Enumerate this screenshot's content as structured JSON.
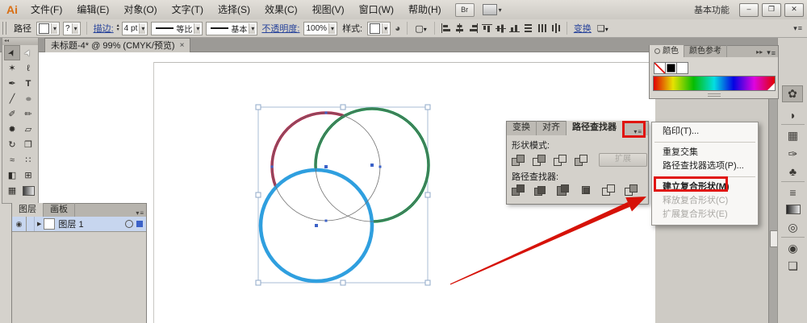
{
  "app": {
    "logo": "Ai",
    "workspace": "基本功能"
  },
  "menubar": {
    "items": [
      "文件(F)",
      "编辑(E)",
      "对象(O)",
      "文字(T)",
      "选择(S)",
      "效果(C)",
      "视图(V)",
      "窗口(W)",
      "帮助(H)"
    ],
    "br": "Br"
  },
  "window_buttons": {
    "minimize": "–",
    "restore": "❐",
    "close": "✕"
  },
  "controlbar": {
    "context": "路径",
    "stroke_question": "?",
    "stroke_label": "描边:",
    "stroke_value": "4 pt",
    "profile_value": "等比",
    "brush_value": "基本",
    "opacity_label": "不透明度:",
    "opacity_value": "100%",
    "style_label": "样式:",
    "transform_link": "变换"
  },
  "doc_tab": {
    "title": "未标题-4* @ 99% (CMYK/预览)",
    "close": "×"
  },
  "toolbar": {
    "tools": [
      {
        "name": "selection-tool",
        "glyph": "➤"
      },
      {
        "name": "direct-selection-tool",
        "glyph": "➤"
      },
      {
        "name": "magic-wand-tool",
        "glyph": "✶"
      },
      {
        "name": "lasso-tool",
        "glyph": "ℓ"
      },
      {
        "name": "pen-tool",
        "glyph": "✒"
      },
      {
        "name": "type-tool",
        "glyph": "T"
      },
      {
        "name": "line-tool",
        "glyph": "╱"
      },
      {
        "name": "ellipse-tool",
        "glyph": "●"
      },
      {
        "name": "paintbrush-tool",
        "glyph": "✐"
      },
      {
        "name": "pencil-tool",
        "glyph": "✏"
      },
      {
        "name": "blob-brush-tool",
        "glyph": "✹"
      },
      {
        "name": "eraser-tool",
        "glyph": "▱"
      },
      {
        "name": "rotate-tool",
        "glyph": "↻"
      },
      {
        "name": "artboard-tool",
        "glyph": "❐"
      },
      {
        "name": "width-tool",
        "glyph": "≈"
      },
      {
        "name": "free-transform-tool",
        "glyph": "∷"
      },
      {
        "name": "shape-builder-tool",
        "glyph": "◧"
      },
      {
        "name": "perspective-grid-tool",
        "glyph": "⊞"
      },
      {
        "name": "mesh-tool",
        "glyph": "▦"
      },
      {
        "name": "gradient-tool",
        "glyph": ""
      }
    ]
  },
  "layers_panel": {
    "tabs": [
      "图层",
      "画板"
    ],
    "layer_name": "图层 1"
  },
  "pathfinder_panel": {
    "tabs": [
      "变换",
      "对齐",
      "路径查找器"
    ],
    "shape_modes_label": "形状模式:",
    "expand_label": "扩展",
    "pathfinders_label": "路径查找器:"
  },
  "context_menu": {
    "items": [
      {
        "label": "陷印(T)...",
        "enabled": true
      },
      {
        "label": "重复交集",
        "enabled": true
      },
      {
        "label": "路径查找器选项(P)...",
        "enabled": true
      },
      {
        "label": "建立复合形状(M)",
        "enabled": true,
        "highlighted": true
      },
      {
        "label": "释放复合形状(C)",
        "enabled": false
      },
      {
        "label": "扩展复合形状(E)",
        "enabled": false
      }
    ]
  },
  "color_panel": {
    "tabs": [
      "颜色",
      "颜色参考"
    ]
  },
  "dock": {
    "icons": [
      {
        "name": "color-icon",
        "glyph": "✿"
      },
      {
        "name": "color-guide-icon",
        "glyph": "◗"
      },
      {
        "name": "swatches-icon",
        "glyph": "▦"
      },
      {
        "name": "brushes-icon",
        "glyph": "✑"
      },
      {
        "name": "symbols-icon",
        "glyph": "♣"
      },
      {
        "name": "stroke-icon",
        "glyph": "≡"
      },
      {
        "name": "gradient-icon",
        "glyph": ""
      },
      {
        "name": "transparency-icon",
        "glyph": "◎"
      },
      {
        "name": "appearance-icon",
        "glyph": "◉"
      },
      {
        "name": "graphic-styles-icon",
        "glyph": "❏"
      }
    ]
  },
  "canvas": {
    "circle_red_stroke": "#ac2a4d",
    "circle_green_stroke": "#1e8b4b",
    "circle_blue_stroke": "#2f9fdf"
  },
  "colors": {
    "highlight_red": "#e01410",
    "arrow_red": "#d61208"
  },
  "icons": {
    "dropdown": "▾",
    "panel_menu": "≡",
    "collapse": "◂◂",
    "expand_arrows": "▸▸",
    "eye": "◉",
    "triangle_right": "▶",
    "stepper_up": "▴",
    "stepper_down": "▾"
  }
}
